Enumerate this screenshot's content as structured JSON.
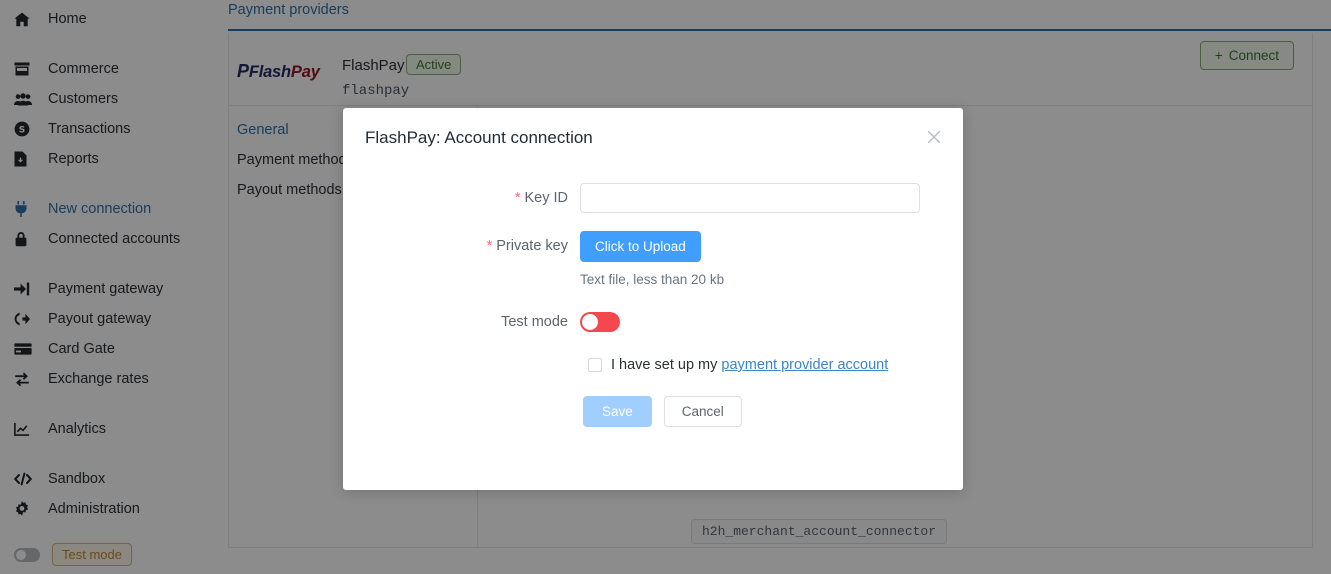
{
  "sidebar": {
    "groups": [
      {
        "items": [
          {
            "label": "Home",
            "icon": "home-icon",
            "active": false
          }
        ]
      },
      {
        "items": [
          {
            "label": "Commerce",
            "icon": "store-icon",
            "active": false
          },
          {
            "label": "Customers",
            "icon": "users-icon",
            "active": false
          },
          {
            "label": "Transactions",
            "icon": "dollar-circle-icon",
            "active": false
          },
          {
            "label": "Reports",
            "icon": "report-file-icon",
            "active": false
          }
        ]
      },
      {
        "items": [
          {
            "label": "New connection",
            "icon": "plug-icon",
            "active": true
          },
          {
            "label": "Connected accounts",
            "icon": "lock-icon",
            "active": false
          }
        ]
      },
      {
        "items": [
          {
            "label": "Payment gateway",
            "icon": "sign-in-icon",
            "active": false
          },
          {
            "label": "Payout gateway",
            "icon": "sign-out-icon",
            "active": false
          },
          {
            "label": "Card Gate",
            "icon": "credit-card-icon",
            "active": false
          },
          {
            "label": "Exchange rates",
            "icon": "exchange-icon",
            "active": false
          }
        ]
      },
      {
        "items": [
          {
            "label": "Analytics",
            "icon": "chart-line-icon",
            "active": false
          }
        ]
      },
      {
        "items": [
          {
            "label": "Sandbox",
            "icon": "code-icon",
            "active": false
          },
          {
            "label": "Administration",
            "icon": "gear-icon",
            "active": false
          }
        ]
      }
    ],
    "test_mode_badge": "Test mode"
  },
  "main": {
    "tabs": [
      {
        "label": "Payment providers",
        "active": true
      }
    ],
    "provider": {
      "logo_p": "P",
      "logo_flash": "Flash",
      "logo_pay": "Pay",
      "name": "FlashPay",
      "status": "Active",
      "code": "flashpay",
      "connect_label": "Connect",
      "connect_plus": "+"
    },
    "subnav": [
      {
        "label": "General",
        "active": true
      },
      {
        "label": "Payment methods",
        "active": false
      },
      {
        "label": "Payout methods",
        "active": false
      }
    ],
    "detail_tag": "h2h_merchant_account_connector"
  },
  "modal": {
    "title": "FlashPay: Account connection",
    "close_icon": "close-icon",
    "fields": {
      "key_id": {
        "label": "Key ID",
        "required_mark": "*",
        "value": "",
        "placeholder": ""
      },
      "private_key": {
        "label": "Private key",
        "required_mark": "*",
        "upload_label": "Click to Upload",
        "hint": "Text file, less than 20 kb"
      },
      "test_mode": {
        "label": "Test mode",
        "state": "off",
        "color": "#f5474e"
      }
    },
    "consent": {
      "checked": false,
      "text": "I have set up my",
      "link_text": "payment provider account"
    },
    "buttons": {
      "save": "Save",
      "save_disabled": true,
      "cancel": "Cancel"
    }
  },
  "colors": {
    "accent_blue": "#409eff",
    "link_blue": "#3a86c8",
    "danger_red": "#f5474e",
    "success_green": "#3f7d28",
    "warning_orange": "#c08b2e"
  }
}
